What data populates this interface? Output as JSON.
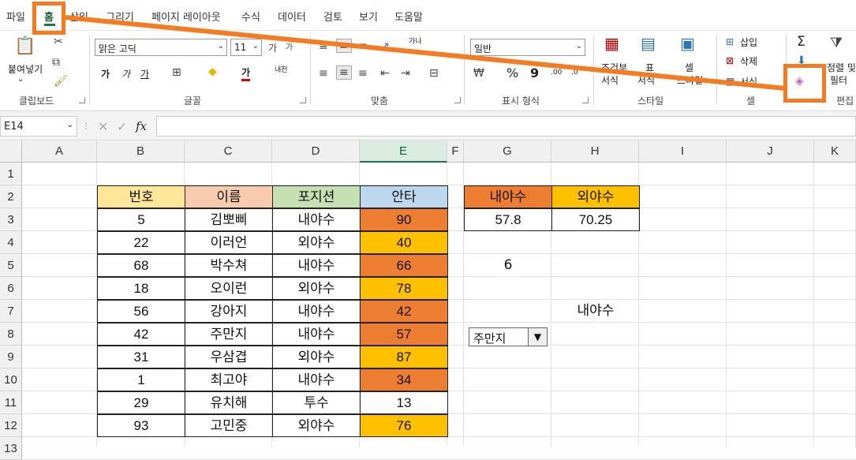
{
  "tabs": [
    "파일",
    "홈",
    "삽입",
    "그리기",
    "페이지 레이아웃",
    "수식",
    "데이터",
    "검토",
    "보기",
    "도움말"
  ],
  "ribbon": {
    "clipboard": {
      "paste_label": "붙여넣기",
      "group_label": "클립보드"
    },
    "font": {
      "font_name": "맑은 고딕",
      "font_size": "11",
      "group_label": "글꼴",
      "bold": "가",
      "italic": "가",
      "underline": "가",
      "fontcolor": "가",
      "phonetic": "내천"
    },
    "alignment": {
      "group_label": "맞춤",
      "wrap": "가나"
    },
    "number": {
      "format": "일반",
      "group_label": "표시 형식",
      "percent": "%",
      "comma": "9",
      "inc": ".00",
      "dec": ".0"
    },
    "styles": {
      "cond_format": "조건부",
      "cond_format2": "서식",
      "table": "표",
      "table2": "서식",
      "cell_styles": "셀",
      "cell_styles2": "스타일",
      "group_label": "스타일"
    },
    "cells": {
      "insert": "삽입",
      "delete": "삭제",
      "format": "서식",
      "group_label": "셀"
    },
    "editing": {
      "sum": "Σ",
      "sort": "정렬 및",
      "filter": "필터",
      "group_label": "편집"
    }
  },
  "formula_bar": {
    "name_box": "E14",
    "fx": "fx",
    "formula": ""
  },
  "columns": [
    "A",
    "B",
    "C",
    "D",
    "E",
    "F",
    "G",
    "H",
    "I",
    "J",
    "K"
  ],
  "rows": [
    "1",
    "2",
    "3",
    "4",
    "5",
    "6",
    "7",
    "8",
    "9",
    "10",
    "11",
    "12",
    "13"
  ],
  "table": {
    "headers": [
      "번호",
      "이름",
      "포지션",
      "안타"
    ],
    "header_colors": [
      "#ffe699",
      "#f8cbad",
      "#c6e0b4",
      "#bdd7ee"
    ],
    "rows": [
      {
        "num": "5",
        "name": "김뽀삐",
        "pos": "내야수",
        "hits": "90",
        "color": "#ed7d31"
      },
      {
        "num": "22",
        "name": "이러언",
        "pos": "외야수",
        "hits": "40",
        "color": "#ffc000"
      },
      {
        "num": "68",
        "name": "박수쳐",
        "pos": "내야수",
        "hits": "66",
        "color": "#ed7d31"
      },
      {
        "num": "18",
        "name": "오이런",
        "pos": "외야수",
        "hits": "78",
        "color": "#ffc000"
      },
      {
        "num": "56",
        "name": "강아지",
        "pos": "내야수",
        "hits": "42",
        "color": "#ed7d31"
      },
      {
        "num": "42",
        "name": "주만지",
        "pos": "내야수",
        "hits": "57",
        "color": "#ed7d31"
      },
      {
        "num": "31",
        "name": "우삼겹",
        "pos": "외야수",
        "hits": "87",
        "color": "#ffc000"
      },
      {
        "num": "1",
        "name": "최고야",
        "pos": "내야수",
        "hits": "34",
        "color": "#ed7d31"
      },
      {
        "num": "29",
        "name": "유치해",
        "pos": "투수",
        "hits": "13",
        "color": "#ffffff"
      },
      {
        "num": "93",
        "name": "고민중",
        "pos": "외야수",
        "hits": "76",
        "color": "#ffc000"
      }
    ]
  },
  "summary": {
    "headers": [
      "내야수",
      "외야수"
    ],
    "header_colors": [
      "#ed7d31",
      "#ffc000"
    ],
    "values": [
      "57.8",
      "70.25"
    ]
  },
  "g5_value": "6",
  "h7_value": "내야수",
  "dropdown": {
    "value": "주만지",
    "arrow": "▼"
  },
  "annotation_color": "#f47b20"
}
